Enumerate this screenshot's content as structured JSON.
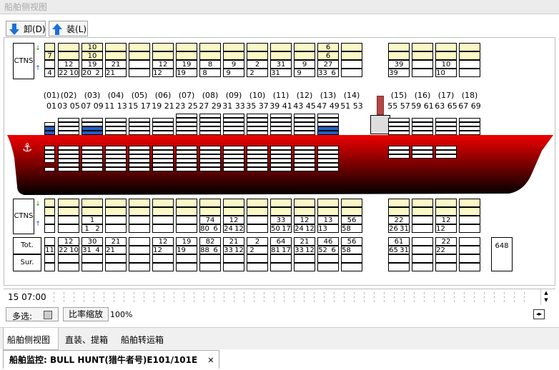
{
  "window": {
    "title": "船舶侧视图"
  },
  "toolbar": {
    "unload_label": "卸(D)",
    "load_label": "装(L)"
  },
  "labels": {
    "ctns": "CTNS",
    "tot": "Tot.",
    "sur": "Sur."
  },
  "bay_headers": [
    {
      "group": "(01)",
      "bays": "01"
    },
    {
      "group": "(02)",
      "bays": "03 05"
    },
    {
      "group": "(03)",
      "bays": "07 09"
    },
    {
      "group": "(04)",
      "bays": "11 13"
    },
    {
      "group": "(05)",
      "bays": "15 17"
    },
    {
      "group": "(06)",
      "bays": "19 21"
    },
    {
      "group": "(07)",
      "bays": "23 25"
    },
    {
      "group": "(08)",
      "bays": "27 29"
    },
    {
      "group": "(09)",
      "bays": "31 33"
    },
    {
      "group": "(10)",
      "bays": "35 37"
    },
    {
      "group": "(11)",
      "bays": "39 41"
    },
    {
      "group": "(12)",
      "bays": "43 45"
    },
    {
      "group": "(13)",
      "bays": "47 49"
    },
    {
      "group": "(14)",
      "bays": "51 53"
    },
    {
      "group": "(15)",
      "bays": "55 57"
    },
    {
      "group": "(16)",
      "bays": "59 61"
    },
    {
      "group": "(17)",
      "bays": "63 65"
    },
    {
      "group": "(18)",
      "bays": "67 69"
    }
  ],
  "top_ctns": [
    {
      "top": "",
      "mid": "7",
      "a": "",
      "b": "",
      "bot": "4",
      "c": ""
    },
    {
      "top": "",
      "mid": "",
      "a": "12",
      "b": "",
      "bot": "22",
      "c": "10"
    },
    {
      "top": "10",
      "mid": "10",
      "a": "19",
      "b": "",
      "bot": "20",
      "c": "2"
    },
    {
      "top": "",
      "mid": "",
      "a": "21",
      "b": "",
      "bot": "21",
      "c": ""
    },
    {
      "top": "",
      "mid": "",
      "a": "",
      "b": "",
      "bot": "",
      "c": ""
    },
    {
      "top": "",
      "mid": "",
      "a": "12",
      "b": "",
      "bot": "12",
      "c": ""
    },
    {
      "top": "",
      "mid": "",
      "a": "19",
      "b": "",
      "bot": "19",
      "c": ""
    },
    {
      "top": "",
      "mid": "",
      "a": "8",
      "b": "",
      "bot": "8",
      "c": ""
    },
    {
      "top": "",
      "mid": "",
      "a": "9",
      "b": "",
      "bot": "9",
      "c": ""
    },
    {
      "top": "",
      "mid": "",
      "a": "2",
      "b": "",
      "bot": "2",
      "c": ""
    },
    {
      "top": "",
      "mid": "",
      "a": "31",
      "b": "",
      "bot": "31",
      "c": ""
    },
    {
      "top": "",
      "mid": "",
      "a": "9",
      "b": "",
      "bot": "9",
      "c": ""
    },
    {
      "top": "6",
      "mid": "6",
      "a": "27",
      "b": "",
      "bot": "33",
      "c": "6"
    },
    {
      "top": "",
      "mid": "",
      "a": "",
      "b": "",
      "bot": "",
      "c": ""
    },
    {
      "top": "",
      "mid": "",
      "a": "39",
      "b": "",
      "bot": "39",
      "c": ""
    },
    {
      "top": "",
      "mid": "",
      "a": "",
      "b": "",
      "bot": "",
      "c": ""
    },
    {
      "top": "",
      "mid": "",
      "a": "10",
      "b": "",
      "bot": "10",
      "c": ""
    },
    {
      "top": "",
      "mid": "",
      "a": "",
      "b": "",
      "bot": "",
      "c": ""
    }
  ],
  "bottom_ctns": [
    {
      "a": "",
      "b": "",
      "c": ""
    },
    {
      "a": "",
      "b": "",
      "c": ""
    },
    {
      "a": "1",
      "b": "1",
      "c": "2"
    },
    {
      "a": "",
      "b": "",
      "c": ""
    },
    {
      "a": "",
      "b": "",
      "c": ""
    },
    {
      "a": "",
      "b": "",
      "c": ""
    },
    {
      "a": "",
      "b": "",
      "c": ""
    },
    {
      "a": "74",
      "b": "80",
      "c": "6"
    },
    {
      "a": "12",
      "b": "24",
      "c": "12"
    },
    {
      "a": "",
      "b": "",
      "c": ""
    },
    {
      "a": "33",
      "b": "50",
      "c": "17"
    },
    {
      "a": "12",
      "b": "24",
      "c": "12"
    },
    {
      "a": "13",
      "b": "13",
      "c": ""
    },
    {
      "a": "56",
      "b": "58",
      "c": ""
    },
    {
      "a": "22",
      "b": "26",
      "c": "31"
    },
    {
      "a": "",
      "b": "",
      "c": ""
    },
    {
      "a": "12",
      "b": "12",
      "c": ""
    },
    {
      "a": "",
      "b": "",
      "c": ""
    }
  ],
  "totals": [
    {
      "a": "",
      "b": "11",
      "c": ""
    },
    {
      "a": "12",
      "b": "22",
      "c": "10"
    },
    {
      "a": "30",
      "b": "31",
      "c": "4"
    },
    {
      "a": "21",
      "b": "21",
      "c": ""
    },
    {
      "a": "",
      "b": "",
      "c": ""
    },
    {
      "a": "12",
      "b": "12",
      "c": ""
    },
    {
      "a": "19",
      "b": "19",
      "c": ""
    },
    {
      "a": "82",
      "b": "88",
      "c": "6"
    },
    {
      "a": "21",
      "b": "33",
      "c": "12"
    },
    {
      "a": "2",
      "b": "2",
      "c": ""
    },
    {
      "a": "64",
      "b": "81",
      "c": "17"
    },
    {
      "a": "21",
      "b": "33",
      "c": "12"
    },
    {
      "a": "46",
      "b": "52",
      "c": "6"
    },
    {
      "a": "56",
      "b": "58",
      "c": ""
    },
    {
      "a": "61",
      "b": "65",
      "c": "31"
    },
    {
      "a": "",
      "b": "",
      "c": ""
    },
    {
      "a": "22",
      "b": "22",
      "c": ""
    },
    {
      "a": "",
      "b": "",
      "c": ""
    }
  ],
  "grand_total": "648",
  "timeline": {
    "time": "15 07:00"
  },
  "controls": {
    "multi_select": "多选:",
    "zoom_button": "比率缩放",
    "zoom_value": "100%"
  },
  "bottom_tabs": [
    "船舶侧视图",
    "直装、提箱",
    "船舶转运箱"
  ],
  "document_tab": {
    "title": "船舶监控: BULL HUNT(猎牛者号)E101/101E",
    "close": "✕"
  },
  "colors": {
    "hull_top": "#ee0000",
    "hull_bottom": "#000000",
    "loaded": "#1e62c8",
    "header_cell": "#fbf8c5"
  }
}
